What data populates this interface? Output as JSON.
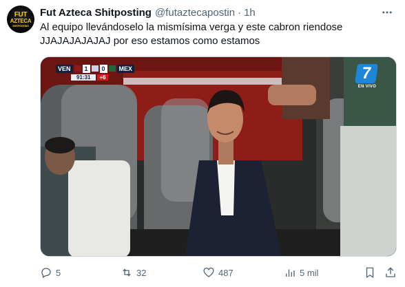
{
  "author": {
    "display_name": "Fut Azteca Shitposting",
    "handle": "@futaztecapostin",
    "time": "1h",
    "avatar_text": [
      "FUT",
      "AZTECA",
      "SHITPOSTING"
    ]
  },
  "tweet": {
    "text": "Al equipo llevándoselo la mismísima verga y este cabron riendose\nJJAJAJAJAJAJ por eso estamos como estamos"
  },
  "media": {
    "scorebug": {
      "home_team": "VEN",
      "home_score": "1",
      "away_score": "0",
      "away_team": "MEX",
      "clock": "91:31",
      "added_time": "+6"
    },
    "channel": {
      "number": "7",
      "live_label": "EN VIVO"
    }
  },
  "actions": {
    "replies": "5",
    "reposts": "32",
    "likes": "487",
    "views": "5 mil"
  },
  "icons": {
    "more": "more-icon",
    "reply": "reply-icon",
    "repost": "repost-icon",
    "like": "heart-icon",
    "views": "views-icon",
    "bookmark": "bookmark-icon",
    "share": "share-icon"
  },
  "colors": {
    "text": "#0f1419",
    "secondary": "#536471",
    "channel_blue": "#1d86d6",
    "added_time_red": "#d11a1a"
  }
}
